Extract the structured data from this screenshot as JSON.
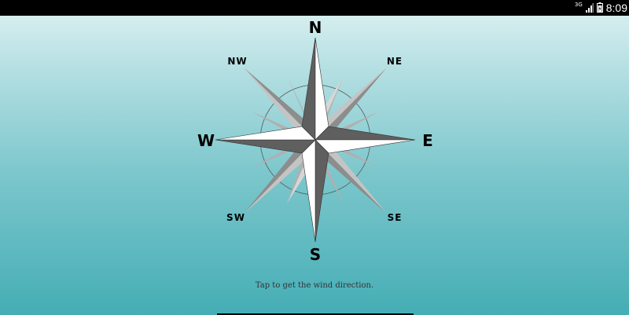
{
  "status_bar": {
    "network": "3G",
    "time": "8:09"
  },
  "compass": {
    "directions": {
      "n": "N",
      "ne": "NE",
      "e": "E",
      "se": "SE",
      "s": "S",
      "sw": "SW",
      "w": "W",
      "nw": "NW"
    }
  },
  "hint_text": "Tap to get the wind direction.",
  "colors": {
    "status_bar": "#000000",
    "rose_dark": "#5f5f5f",
    "rose_light": "#ffffff",
    "rose_grey": "#b5b5b5",
    "rose_light_grey": "#dcdcdc"
  },
  "icons": [
    "signal-icon",
    "battery-icon"
  ]
}
